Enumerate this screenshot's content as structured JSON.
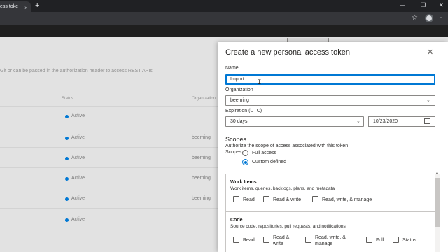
{
  "browser": {
    "tab_title": "ess toke",
    "tab_close": "×",
    "new_tab": "+",
    "minimize": "—",
    "restore": "❐",
    "close": "✕",
    "bookmark_icon": "☆",
    "menu_icon": "⋮"
  },
  "background": {
    "description": "Git or can be passed in the authorization header to access REST APIs",
    "columns": {
      "status": "Status",
      "organization": "Organization"
    },
    "rows": [
      {
        "status": "Active",
        "organization": ""
      },
      {
        "status": "Active",
        "organization": "beeming"
      },
      {
        "status": "Active",
        "organization": "beeming"
      },
      {
        "status": "Active",
        "organization": "beeming"
      },
      {
        "status": "Active",
        "organization": "beeming"
      },
      {
        "status": "Active",
        "organization": ""
      }
    ]
  },
  "panel": {
    "title": "Create a new personal access token",
    "close_icon": "✕",
    "name_label": "Name",
    "name_value": "Import",
    "organization_label": "Organization",
    "organization_value": "beeming",
    "expiration_label": "Expiration (UTC)",
    "expiration_value": "30 days",
    "expiration_date": "10/23/2020",
    "scopes_title": "Scopes",
    "scopes_desc": "Authorize the scope of access associated with this token",
    "scopes_label": "Scopes",
    "radio_full": "Full access",
    "radio_custom": "Custom defined",
    "selected_scope_mode": "Custom defined",
    "work_items": {
      "name": "Work Items",
      "desc": "Work items, queries, backlogs, plans, and metadata",
      "opt_read": "Read",
      "opt_read_write": "Read & write",
      "opt_read_write_manage": "Read, write, & manage"
    },
    "code": {
      "name": "Code",
      "desc": "Source code, repositories, pull requests, and notifications",
      "opt_read": "Read",
      "opt_read_write_1": "Read &",
      "opt_read_write_2": "write",
      "opt_rwm_1": "Read, write, &",
      "opt_rwm_2": "manage",
      "opt_full": "Full",
      "opt_status": "Status"
    }
  },
  "colors": {
    "accent": "#0078d4",
    "chrome_dark": "#202124",
    "overlay": "#e2e2e2"
  }
}
